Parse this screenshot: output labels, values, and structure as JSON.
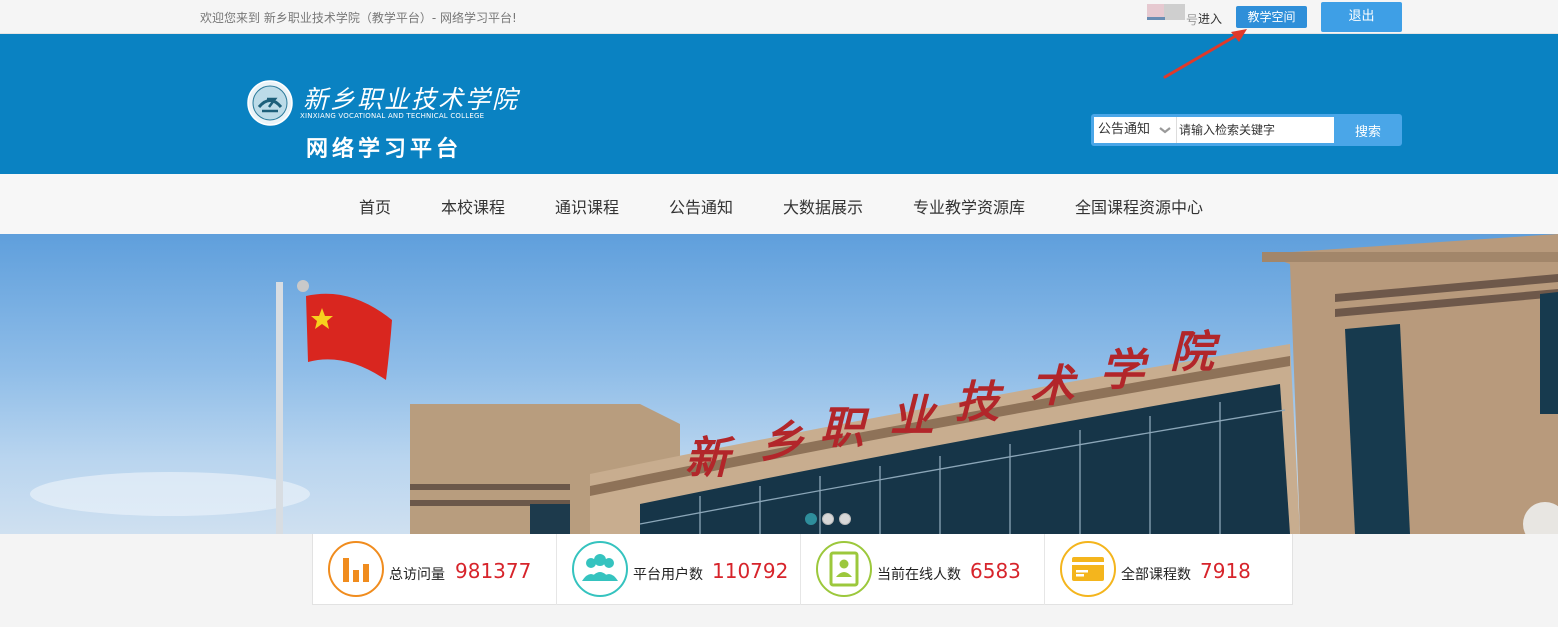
{
  "topbar": {
    "welcome": "欢迎您来到 新乡职业技术学院（教学平台）- 网络学习平台!",
    "user_tail": "号",
    "enter": "进入",
    "space_button": "教学空间",
    "logout_button": "退出"
  },
  "header": {
    "logo_cn": "新乡职业技术学院",
    "logo_en": "XINXIANG VOCATIONAL AND TECHNICAL COLLEGE",
    "platform_title": "网络学习平台",
    "search": {
      "selected": "公告通知",
      "placeholder": "请输入检索关键字",
      "button": "搜索"
    }
  },
  "nav": {
    "items": [
      "首页",
      "本校课程",
      "通识课程",
      "公告通知",
      "大数据展示",
      "专业教学资源库",
      "全国课程资源中心"
    ]
  },
  "banner": {
    "sign_chars": [
      "新",
      "乡",
      "职",
      "业",
      "技",
      "术",
      "学",
      "院"
    ],
    "slide_count": 3,
    "active_slide": 1
  },
  "stats": [
    {
      "label": "总访问量",
      "value": "981377",
      "icon": "bar-chart-icon",
      "color": "#f08c1e"
    },
    {
      "label": "平台用户数",
      "value": "110792",
      "icon": "users-icon",
      "color": "#35c3bf"
    },
    {
      "label": "当前在线人数",
      "value": "6583",
      "icon": "online-user-icon",
      "color": "#9cc83c"
    },
    {
      "label": "全部课程数",
      "value": "7918",
      "icon": "course-card-icon",
      "color": "#f4b51d"
    }
  ],
  "colors": {
    "header_blue": "#0a82c2",
    "button_blue": "#2f8fd9",
    "stat_red": "#d7242b",
    "arrow_red": "#e0392a"
  }
}
